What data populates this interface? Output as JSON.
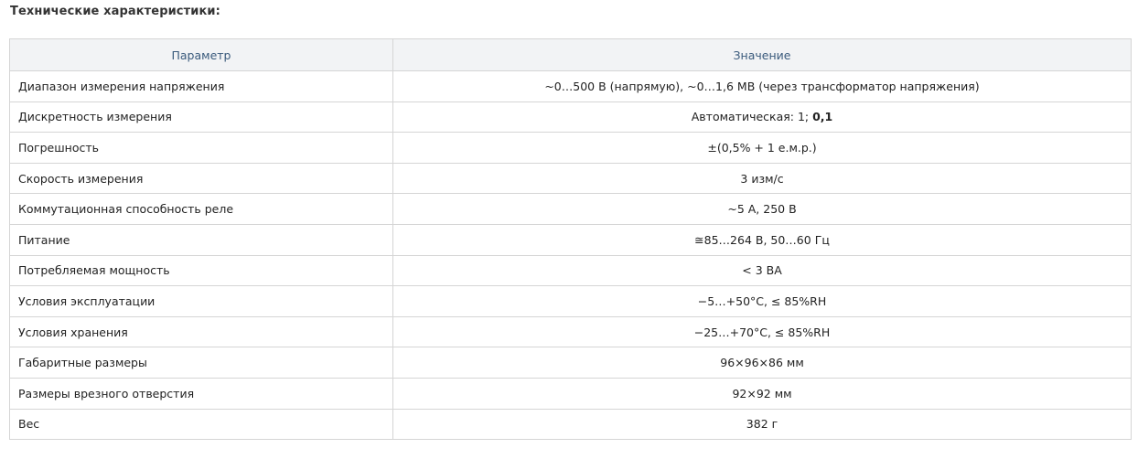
{
  "section_title": "Технические характеристики:",
  "table": {
    "headers": [
      "Параметр",
      "Значение"
    ],
    "rows": [
      {
        "param": "Диапазон измерения напряжения",
        "value": "~0…500 В (напрямую), ~0…1,6 МВ (через трансформатор напряжения)"
      },
      {
        "param": "Дискретность измерения",
        "value": "Автоматическая: 1; ",
        "value_bold": "0,1"
      },
      {
        "param": "Погрешность",
        "value": "±(0,5% + 1 е.м.р.)"
      },
      {
        "param": "Скорость измерения",
        "value": "3 изм/с"
      },
      {
        "param": "Коммутационная способность реле",
        "value": "~5 А, 250 В"
      },
      {
        "param": "Питание",
        "value": "≅85…264 В, 50…60 Гц"
      },
      {
        "param": "Потребляемая мощность",
        "value": "< 3 ВА"
      },
      {
        "param": "Условия эксплуатации",
        "value": "−5…+50°C, ≤ 85%RH"
      },
      {
        "param": "Условия хранения",
        "value": "−25…+70°C, ≤ 85%RH"
      },
      {
        "param": "Габаритные размеры",
        "value": "96×96×86 мм"
      },
      {
        "param": "Размеры врезного отверстия",
        "value": "92×92 мм"
      },
      {
        "param": "Вес",
        "value": "382 г"
      }
    ]
  }
}
